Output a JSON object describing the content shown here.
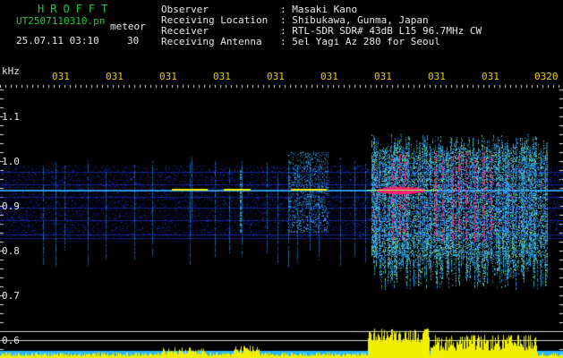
{
  "header": {
    "title": "HROFFT",
    "filename": "UT2507110310.pn",
    "mode": "meteor",
    "date": "25.07.11 03:10",
    "duration": "30"
  },
  "info": {
    "labels": [
      "Observer",
      "Receiving Location",
      "Receiver",
      "Receiving Antenna"
    ],
    "values": [
      ": Masaki Kano",
      ": Shibukawa, Gunma, Japan",
      ": RTL-SDR SDR# 43dB L15 96.7MHz CW",
      ": 5el Yagi Az 280 for Seoul"
    ]
  },
  "axis": {
    "unit": "kHz",
    "y_ticks": [
      "1.1",
      "1.0",
      "0.9",
      "0.8",
      "0.7",
      "0.6"
    ],
    "x_ticks": [
      "031",
      "031",
      "031",
      "031",
      "031",
      "031",
      "031",
      "031",
      "031",
      "0320"
    ]
  },
  "colors": {
    "noise": "#1e3cff",
    "weak": "#33a8ff",
    "mid": "#2fd0ff",
    "strong": "#9aff6a",
    "hot": "#ff2070",
    "trace": "#f0f000",
    "baseline": "#2ab4ff"
  }
}
